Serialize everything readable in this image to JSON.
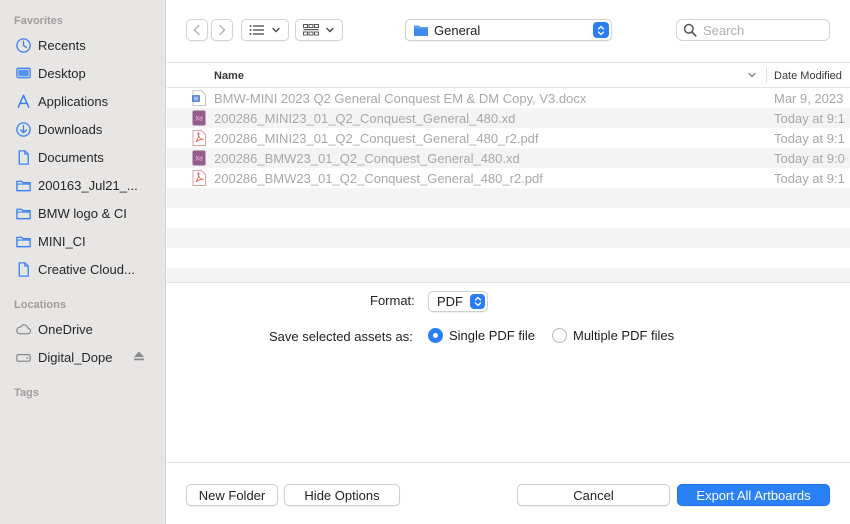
{
  "sidebar": {
    "favorites_title": "Favorites",
    "favorites": [
      {
        "label": "Recents",
        "icon": "clock-icon"
      },
      {
        "label": "Desktop",
        "icon": "desktop-icon"
      },
      {
        "label": "Applications",
        "icon": "applications-icon"
      },
      {
        "label": "Downloads",
        "icon": "downloads-icon"
      },
      {
        "label": "Documents",
        "icon": "document-icon"
      },
      {
        "label": "200163_Jul21_...",
        "icon": "folder-icon"
      },
      {
        "label": "BMW logo & CI",
        "icon": "folder-icon"
      },
      {
        "label": "MINI_CI",
        "icon": "folder-icon"
      },
      {
        "label": "Creative Cloud...",
        "icon": "document-icon"
      }
    ],
    "locations_title": "Locations",
    "locations": [
      {
        "label": "OneDrive",
        "icon": "cloud-icon"
      },
      {
        "label": "Digital_Dope",
        "icon": "drive-icon"
      }
    ],
    "tags_title": "Tags"
  },
  "toolbar": {
    "current_folder": "General",
    "search_placeholder": "Search"
  },
  "file_list": {
    "columns": {
      "name": "Name",
      "date": "Date Modified"
    },
    "files": [
      {
        "name": "BMW-MINI 2023 Q2 General Conquest EM & DM Copy, V3.docx",
        "date": "Mar 9, 2023",
        "icon": "word-doc-icon"
      },
      {
        "name": "200286_MINI23_01_Q2_Conquest_General_480.xd",
        "date": "Today at 9:1",
        "icon": "xd-file-icon"
      },
      {
        "name": "200286_MINI23_01_Q2_Conquest_General_480_r2.pdf",
        "date": "Today at 9:1",
        "icon": "pdf-file-icon"
      },
      {
        "name": "200286_BMW23_01_Q2_Conquest_General_480.xd",
        "date": "Today at 9:0",
        "icon": "xd-file-icon"
      },
      {
        "name": "200286_BMW23_01_Q2_Conquest_General_480_r2.pdf",
        "date": "Today at 9:1",
        "icon": "pdf-file-icon"
      }
    ]
  },
  "options": {
    "format_label": "Format:",
    "format_value": "PDF",
    "save_as_label": "Save selected assets as:",
    "single_pdf": "Single PDF file",
    "multiple_pdf": "Multiple PDF files",
    "selected": "single"
  },
  "buttons": {
    "new_folder": "New Folder",
    "hide_options": "Hide Options",
    "cancel": "Cancel",
    "export": "Export All Artboards"
  },
  "colors": {
    "accent": "#2a7ef5",
    "sidebar_bg": "#e8e6e5",
    "icon_blue": "#3a82f0"
  }
}
